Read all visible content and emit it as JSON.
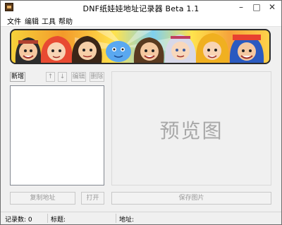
{
  "window": {
    "title": "DNF纸娃娃地址记录器 Beta 1.1",
    "minimize_glyph": "–",
    "maximize_glyph": "□",
    "close_glyph": "✕"
  },
  "menu": {
    "items": [
      {
        "label": "文件"
      },
      {
        "label": "编辑"
      },
      {
        "label": "工具"
      },
      {
        "label": "帮助"
      }
    ]
  },
  "banner": {
    "icon": "cartoon-characters-banner"
  },
  "toolbar": {
    "new_label": "新增",
    "up_label": "↑",
    "down_label": "↓",
    "edit_label": "编辑",
    "delete_label": "删除"
  },
  "list": {
    "items": []
  },
  "preview": {
    "placeholder": "预览图"
  },
  "actions": {
    "copy_address_label": "复制地址",
    "open_label": "打开",
    "save_image_label": "保存图片"
  },
  "status": {
    "count_text": "记录数: 0",
    "title_text": "标题:",
    "address_text": "地址:"
  }
}
